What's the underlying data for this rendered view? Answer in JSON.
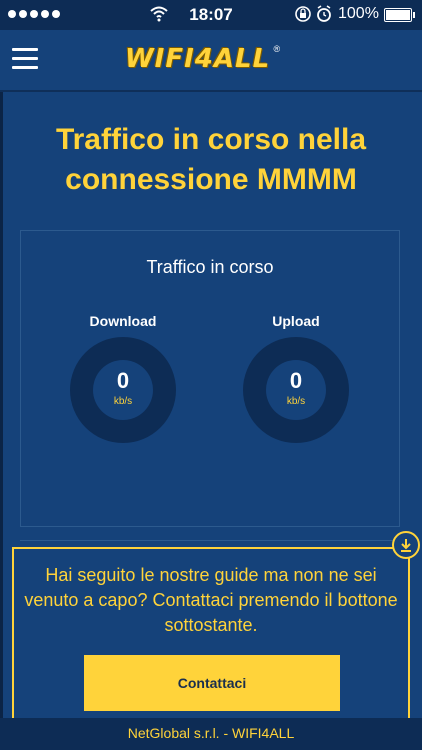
{
  "status_bar": {
    "time": "18:07",
    "battery_percent": "100%"
  },
  "header": {
    "logo_text": "WIFI4ALL",
    "logo_registered": "®"
  },
  "main": {
    "title": "Traffico in corso nella connessione MMMM"
  },
  "traffic_card": {
    "title": "Traffico in corso",
    "download": {
      "label": "Download",
      "value": "0",
      "unit": "kb/s"
    },
    "upload": {
      "label": "Upload",
      "value": "0",
      "unit": "kb/s"
    }
  },
  "contact_panel": {
    "text": "Hai seguito le nostre guide ma non ne sei venuto a capo? Contattaci premendo il bottone sottostante.",
    "button_label": "Contattaci"
  },
  "footer": {
    "text": "NetGlobal s.r.l. - WIFI4ALL"
  },
  "colors": {
    "background": "#15427a",
    "dark_navy": "#0d2c55",
    "accent_yellow": "#ffd33a"
  },
  "icons": [
    "signal-dots-icon",
    "wifi-icon",
    "rotation-lock-icon",
    "alarm-icon",
    "battery-icon",
    "hamburger-menu-icon",
    "download-arrow-icon"
  ]
}
